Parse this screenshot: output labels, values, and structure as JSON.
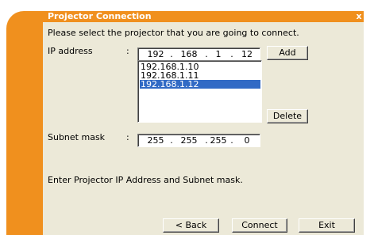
{
  "window": {
    "title": "Projector Connection",
    "close_glyph": "x"
  },
  "instruction": "Please select the projector that you are going to connect.",
  "ip_address": {
    "label": "IP address",
    "colon": ":",
    "octets": [
      "192",
      "168",
      "1",
      "12"
    ],
    "dot": "."
  },
  "subnet_mask": {
    "label": "Subnet mask",
    "colon": ":",
    "octets": [
      "255",
      "255",
      "255",
      "0"
    ],
    "dot": "."
  },
  "projector_list": {
    "items": [
      "192.168.1.10",
      "192.168.1.11",
      "192.168.1.12"
    ],
    "selected_value": "192.168.1.12"
  },
  "buttons": {
    "add": "Add",
    "delete": "Delete",
    "back": "< Back",
    "connect": "Connect",
    "exit": "Exit"
  },
  "status_message": "Enter Projector IP Address and Subnet mask.",
  "colors": {
    "accent_orange": "#f0901e",
    "panel_bg": "#ece9d8",
    "selection_blue": "#316ac5"
  }
}
